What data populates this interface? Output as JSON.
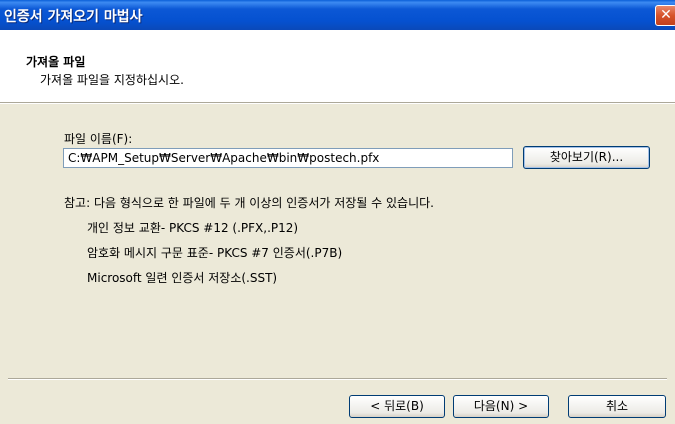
{
  "window": {
    "title": "인증서 가져오기 마법사",
    "close_glyph": "✕"
  },
  "header": {
    "title": "가져올 파일",
    "subtitle": "가져올 파일을 지정하십시오."
  },
  "file": {
    "label": "파일 이름(F):",
    "value": "C:₩APM_Setup₩Server₩Apache₩bin₩postech.pfx",
    "browse_label": "찾아보기(R)..."
  },
  "note": {
    "text": "참고: 다음 형식으로 한 파일에 두 개 이상의 인증서가 저장될 수 있습니다.",
    "formats": [
      "개인 정보 교환- PKCS #12 (.PFX,.P12)",
      "암호화 메시지 구문 표준- PKCS #7 인증서(.P7B)",
      "Microsoft 일련 인증서 저장소(.SST)"
    ]
  },
  "footer": {
    "back_label": "< 뒤로(B)",
    "next_label": "다음(N) >",
    "cancel_label": "취소"
  }
}
